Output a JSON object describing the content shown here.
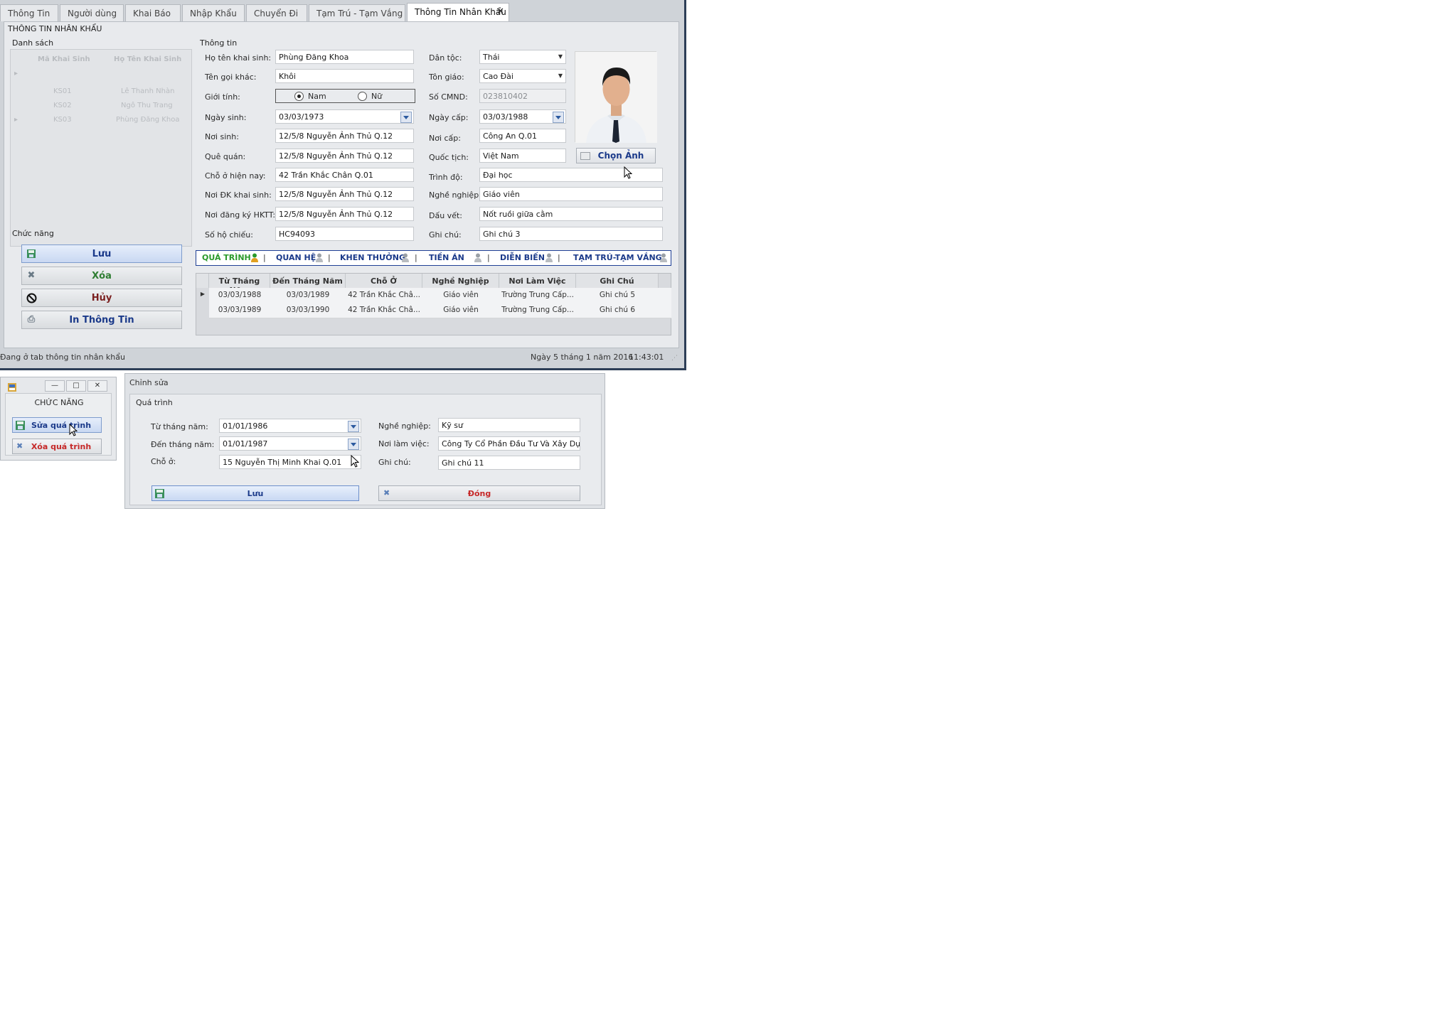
{
  "tabs": [
    "Thông Tin",
    "Người dùng",
    "Khai Báo",
    "Nhập Khẩu",
    "Chuyển Đi",
    "Tạm Trú - Tạm Vắng",
    "Thông Tin Nhân Khẩu"
  ],
  "active_tab_close": "✕",
  "page_title": "THÔNG TIN NHÂN KHẨU",
  "list_section": {
    "title": "Danh sách",
    "columns": [
      "Mã Khai Sinh",
      "Họ Tên Khai Sinh"
    ],
    "rows": [
      {
        "id": "KS01",
        "name": "Lê Thanh Nhàn"
      },
      {
        "id": "KS02",
        "name": "Ngô Thu Trang"
      },
      {
        "id": "KS03",
        "name": "Phùng Đăng Khoa"
      }
    ]
  },
  "functions": {
    "title": "Chức năng",
    "save": "Lưu",
    "delete": "Xóa",
    "cancel": "Hủy",
    "print": "In Thông Tin"
  },
  "info": {
    "title": "Thông tin",
    "left": [
      {
        "label": "Họ tên khai sinh:",
        "value": "Phùng Đăng Khoa"
      },
      {
        "label": "Tên gọi khác:",
        "value": "Khôi"
      },
      {
        "label": "Giới tính:",
        "value": ""
      },
      {
        "label": "Ngày sinh:",
        "value": "03/03/1973"
      },
      {
        "label": "Nơi sinh:",
        "value": "12/5/8 Nguyễn Ảnh Thủ Q.12"
      },
      {
        "label": "Quê quán:",
        "value": "12/5/8 Nguyễn Ảnh Thủ Q.12"
      },
      {
        "label": "Chỗ ở hiện nay:",
        "value": "42 Trần Khắc Chân Q.01"
      },
      {
        "label": "Nơi ĐK khai sinh:",
        "value": "12/5/8 Nguyễn Ảnh Thủ Q.12"
      },
      {
        "label": "Nơi đăng ký HKTT:",
        "value": "12/5/8 Nguyễn Ảnh Thủ Q.12"
      },
      {
        "label": "Số hộ chiếu:",
        "value": "HC94093"
      }
    ],
    "gender_options": [
      "Nam",
      "Nữ"
    ],
    "gender_selected": "Nam",
    "right": [
      {
        "label": "Dân tộc:",
        "value": "Thái"
      },
      {
        "label": "Tôn giáo:",
        "value": "Cao Đài"
      },
      {
        "label": "Số CMND:",
        "value": "023810402"
      },
      {
        "label": "Ngày cấp:",
        "value": "03/03/1988"
      },
      {
        "label": "Nơi cấp:",
        "value": "Công An Q.01"
      },
      {
        "label": "Quốc tịch:",
        "value": "Việt Nam"
      },
      {
        "label": "Trình độ:",
        "value": "Đại học"
      },
      {
        "label": "Nghề nghiệp:",
        "value": "Giáo viên"
      },
      {
        "label": "Dấu vết:",
        "value": "Nốt ruồi giữa cằm"
      },
      {
        "label": "Ghi chú:",
        "value": "Ghi chú 3"
      }
    ],
    "choose_photo": "Chọn Ảnh"
  },
  "subtabs": [
    "QUÁ TRÌNH",
    "QUAN HỆ",
    "KHEN THƯỞNG",
    "TIỀN ÁN",
    "DIỄN BIẾN",
    "TẠM TRÚ-TẠM VẮNG"
  ],
  "history_grid": {
    "columns": [
      "Từ Tháng Năm",
      "Đến Tháng Năm",
      "Chỗ Ở",
      "Nghề Nghiệp",
      "Nơi Làm Việc",
      "Ghi Chú"
    ],
    "rows": [
      [
        "03/03/1988",
        "03/03/1989",
        "42 Trần Khắc Châ...",
        "Giáo viên",
        "Trường Trung Cấp...",
        "Ghi chú 5"
      ],
      [
        "03/03/1989",
        "03/03/1990",
        "42 Trần Khắc Châ...",
        "Giáo viên",
        "Trường Trung Cấp...",
        "Ghi chú 6"
      ]
    ]
  },
  "status": {
    "message": "Đang ở tab thông tin nhân khẩu",
    "date": "Ngày 5 tháng 1 năm 2016",
    "time": "11:43:01"
  },
  "func_popup": {
    "title": "CHỨC NĂNG",
    "edit": "Sửa quá trình",
    "delete": "Xóa quá trình"
  },
  "edit_dialog": {
    "title": "Chỉnh sửa",
    "group": "Quá trình",
    "from_label": "Từ tháng năm:",
    "from_value": "01/01/1986",
    "to_label": "Đến tháng năm:",
    "to_value": "01/01/1987",
    "address_label": "Chỗ ở:",
    "address_value": "15 Nguyễn Thị Minh Khai Q.01",
    "job_label": "Nghề nghiệp:",
    "job_value": "Kỹ sư",
    "workplace_label": "Nơi làm việc:",
    "workplace_value": "Công Ty Cổ Phần Đầu Tư Và Xây Dựng N",
    "note_label": "Ghi chú:",
    "note_value": "Ghi chú 11",
    "save": "Lưu",
    "close": "Đóng"
  },
  "colors": {
    "accent_blue": "#1b3a8a",
    "delete_green": "#2e7d32",
    "cancel_red": "#7a1f1f",
    "close_red": "#c62828",
    "status_green": "#2b9a2b"
  }
}
